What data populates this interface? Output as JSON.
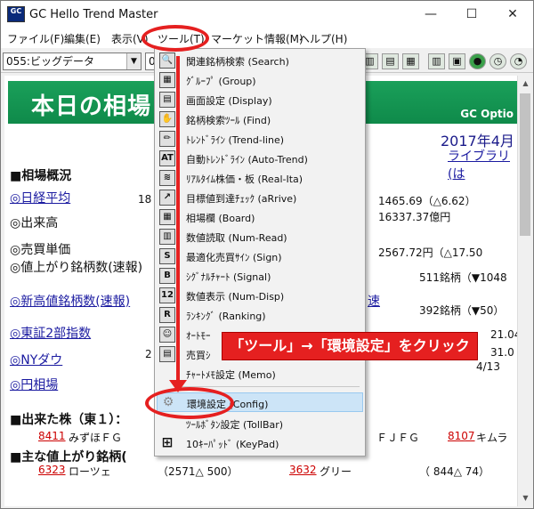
{
  "window": {
    "title": "GC Hello Trend Master",
    "app_icon_text": "GC",
    "minimize": "—",
    "maximize": "☐",
    "close": "✕"
  },
  "menubar": {
    "items": [
      "ファイル(F)",
      "編集(E)",
      "表示(V)",
      "ツール(T)",
      "マーケット情報(M)",
      "ヘルプ(H)"
    ]
  },
  "toolbar": {
    "combo_value": "055:ビッグデータ",
    "combo2_value": "0"
  },
  "content": {
    "banner_title": "本日の相場",
    "banner_sub": "GC Optio",
    "date": "2017年4月",
    "library_link": "ライブラリ(は",
    "section1": "■相場概況",
    "rows": [
      {
        "label": "◎日経平均",
        "mid": "18",
        "value": "1465.69（△6.62）",
        "link": true
      },
      {
        "label": "◎出来高",
        "mid": "",
        "value": "16337.37億円",
        "link": false
      },
      {
        "label": "◎売買単価",
        "mid": "",
        "value": "2567.72円（△17.50",
        "link": false
      },
      {
        "label": "◎値上がり銘柄数(速報)",
        "mid": "",
        "value": "511銘柄（▼1048",
        "link": false
      },
      {
        "label": "◎新高値銘柄数(速報)",
        "mid": "",
        "value": "392銘柄（▼50）",
        "link": true
      },
      {
        "label": "◎東証2部指数",
        "mid": "",
        "value": "21.04",
        "link": true
      },
      {
        "label": "◎NYダウ",
        "mid": "2",
        "value": "31.0",
        "link": true
      },
      {
        "label": "◎円相場",
        "mid": "",
        "value": "4/13",
        "link": true
      }
    ],
    "section2": "■出来た株（東１）：",
    "stock_row1": {
      "code": "8411",
      "name": "みずほＦＧ",
      "tail": "ＦＪＦＧ",
      "code2": "8107",
      "name2": "キムラ"
    },
    "section3": "■主な値上がり銘柄(",
    "stock_row2": {
      "code": "6323",
      "name": "ローツェ",
      "mid": "（2571△ 500）",
      "code2": "3632",
      "name2": "グリー",
      "tail": "（ 844△ 74）"
    },
    "extra_link": "速"
  },
  "tools_menu": {
    "items": [
      {
        "icon": "🔍",
        "label": "関連銘柄検索 (Search)"
      },
      {
        "icon": "▦",
        "label": "ｸﾞﾙｰﾌﾟ (Group)"
      },
      {
        "icon": "▤",
        "label": "画面設定 (Display)"
      },
      {
        "icon": "✋",
        "label": "銘柄検索ﾂｰﾙ (Find)"
      },
      {
        "icon": "✏",
        "label": "ﾄﾚﾝﾄﾞﾗｲﾝ (Trend-line)"
      },
      {
        "icon": "AT",
        "label": "自動ﾄﾚﾝﾄﾞﾗｲﾝ (Auto-Trend)"
      },
      {
        "icon": "≋",
        "label": "ﾘｱﾙﾀｲﾑ株価・板 (Real-Ita)"
      },
      {
        "icon": "↗",
        "label": "目標値到達ﾁｪｯｸ (aRrive)"
      },
      {
        "icon": "▦",
        "label": "相場欄 (Board)"
      },
      {
        "icon": "▥",
        "label": "数値読取 (Num-Read)"
      },
      {
        "icon": "S",
        "label": "最適化売買ｻｲﾝ (Sign)"
      },
      {
        "icon": "B",
        "label": "ｼｸﾞﾅﾙﾁｬｰﾄ (Signal)"
      },
      {
        "icon": "12",
        "label": "数値表示 (Num-Disp)"
      },
      {
        "icon": "R",
        "label": "ﾗﾝｷﾝｸﾞ (Ranking)"
      },
      {
        "icon": "☺",
        "label": "ｵｰﾄﾓｰ"
      },
      {
        "icon": "▤",
        "label": "売買ｼ"
      },
      {
        "icon": "",
        "label": "ﾁｬｰﾄﾒﾓ設定 (Memo)"
      },
      {
        "icon": "⚙",
        "label": "環境設定 (Config)"
      },
      {
        "icon": "",
        "label": "ﾂｰﾙﾎﾞﾀﾝ設定 (TollBar)"
      },
      {
        "icon": "⊞",
        "label": "10ｷｰﾊﾟｯﾄﾞ (KeyPad)"
      }
    ]
  },
  "callout": "「ツール」→「環境設定」をクリック",
  "accent_red": "#e52020"
}
